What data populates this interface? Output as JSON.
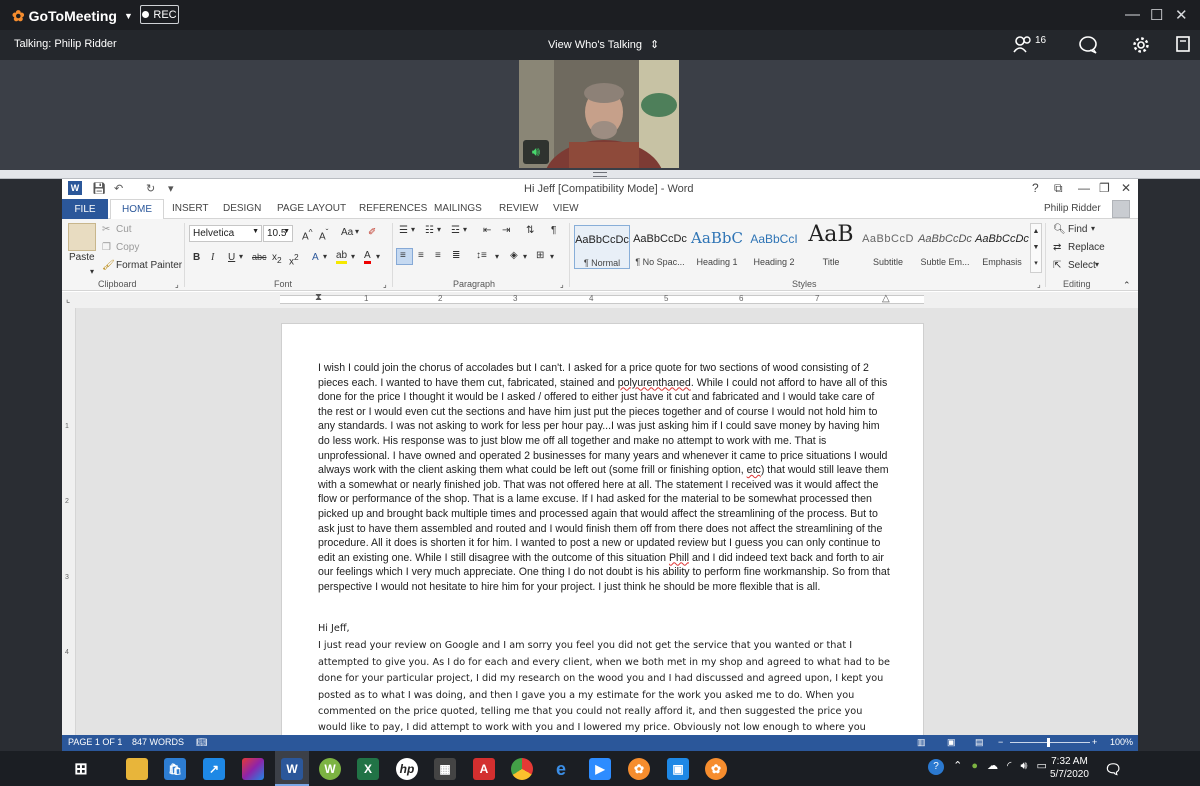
{
  "gtm": {
    "app_name": "GoToMeeting",
    "rec_label": "REC",
    "talking": "Talking: Philip Ridder",
    "view_whos_talking": "View Who's Talking",
    "participant_count": "16"
  },
  "word": {
    "window_title": "Hi Jeff [Compatibility Mode] - Word",
    "tabs": [
      "FILE",
      "HOME",
      "INSERT",
      "DESIGN",
      "PAGE LAYOUT",
      "REFERENCES",
      "MAILINGS",
      "REVIEW",
      "VIEW"
    ],
    "user_name": "Philip Ridder",
    "clipboard": {
      "paste": "Paste",
      "cut": "Cut",
      "copy": "Copy",
      "format_painter": "Format Painter",
      "label": "Clipboard"
    },
    "font": {
      "name": "Helvetica",
      "size": "10.5",
      "label": "Font",
      "change_case": "Aa"
    },
    "paragraph": {
      "label": "Paragraph"
    },
    "styles": {
      "label": "Styles",
      "items": [
        {
          "sample": "AaBbCcDc",
          "name": "¶ Normal"
        },
        {
          "sample": "AaBbCcDc",
          "name": "¶ No Spac..."
        },
        {
          "sample": "AaBbC",
          "name": "Heading 1"
        },
        {
          "sample": "AaBbCcI",
          "name": "Heading 2"
        },
        {
          "sample": "AaB",
          "name": "Title"
        },
        {
          "sample": "AaBbCcD",
          "name": "Subtitle"
        },
        {
          "sample": "AaBbCcDc",
          "name": "Subtle Em..."
        },
        {
          "sample": "AaBbCcDc",
          "name": "Emphasis"
        }
      ]
    },
    "editing": {
      "find": "Find",
      "replace": "Replace",
      "select": "Select",
      "label": "Editing"
    },
    "ruler_numbers": [
      "1",
      "2",
      "3",
      "4",
      "5",
      "6",
      "7"
    ],
    "vruler_numbers": [
      "1",
      "2",
      "3",
      "4"
    ],
    "document": {
      "para1_a": "I wish I could join the chorus of accolades but I can't. I asked for a price quote for two sections of wood consisting of 2 pieces each. I wanted to have them cut, fabricated, stained and ",
      "para1_word1": "polyurenthaned",
      "para1_b": ". While I could not afford to have all of this done for the price I thought it would be I asked / offered to either just have it cut and fabricated and I would take care of the rest or I would even cut the sections and have him just put the pieces together and of course I would not hold him to any standards. I was not asking to work for less per hour pay...I was just asking him if I could save money by having him do less work. His response was to just blow me off all together and make no attempt to work with me. That is unprofessional. I have owned and operated 2 businesses for many years and whenever it came to price situations I would always work with the client asking them what could be left out (some frill or finishing option, ",
      "para1_word2": "etc",
      "para1_c": ") that would still leave them with a somewhat or nearly finished job. That was not offered here at all. The statement I received was it would affect the flow or performance of the shop. That is a lame excuse. If I had asked for the material to be somewhat processed then picked up and brought back multiple times and processed again that would affect the streamlining of the process. But to ask just to have them assembled and routed and I would finish them off from there does not affect the streamlining of the procedure. All it does is shorten it for him. I wanted to post a new or updated review but I guess you can only continue to edit an existing one. While I still disagree with the outcome of this situation ",
      "para1_word3": "Phill",
      "para1_d": " and I did indeed text back and forth to air our feelings which I very much appreciate. One thing I do not doubt is his ability to perform fine workmanship. So from that perspective I would not hesitate to hire him for your project. I just think he should be more flexible that is all.",
      "greeting": "Hi Jeff,",
      "reply": "I just read your review on Google and I am sorry you feel you did not get the service that you wanted or that I attempted to give you. As I do for each and every client, when we both met in my shop and agreed to what had to be done for your particular project, I did my research on the wood you and I had discussed and agreed upon, I kept you posted as to what I was doing, and then I gave you a my estimate for the work you asked me to do. When you commented on the price quoted, telling me that you could not really afford it, and then suggested the price you would like to pay, I did attempt to work with you and I lowered my price. Obviously not low enough to where you wanted it to be. But I did not, in any"
    },
    "status": {
      "page": "PAGE 1 OF 1",
      "words": "847 WORDS",
      "zoom": "100%"
    }
  },
  "taskbar": {
    "time": "7:32 AM",
    "date": "5/7/2020"
  },
  "colors": {
    "word_blue": "#2b579a",
    "gtm_orange": "#f68d2e"
  }
}
